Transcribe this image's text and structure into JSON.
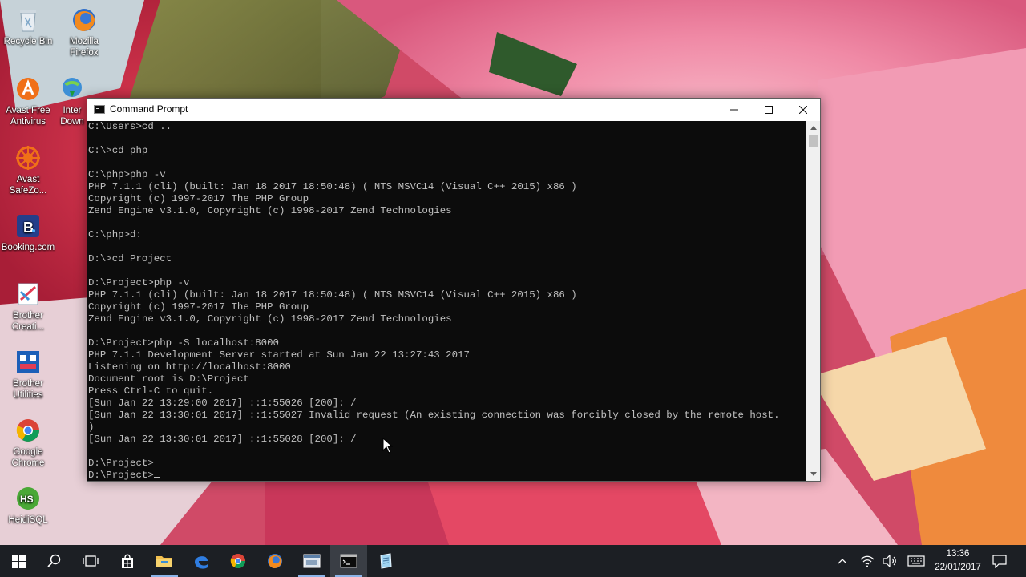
{
  "desktop": {
    "icons": [
      {
        "label": "Recycle Bin",
        "icon": "recycle-bin-icon"
      },
      {
        "label": "Mozilla Firefox",
        "icon": "firefox-icon"
      },
      {
        "label": "Avast Free Antivirus",
        "icon": "avast-icon"
      },
      {
        "label": "Inter Down",
        "icon": "internet-download-manager-icon"
      },
      {
        "label": "Avast SafeZo...",
        "icon": "avast-safezone-icon"
      },
      {
        "label": "Booking.com",
        "icon": "booking-icon"
      },
      {
        "label": "Brother Creati...",
        "icon": "brother-creative-icon"
      },
      {
        "label": "Brother Utilities",
        "icon": "brother-utilities-icon"
      },
      {
        "label": "Google Chrome",
        "icon": "chrome-icon"
      },
      {
        "label": "HeidiSQL",
        "icon": "heidisql-icon"
      }
    ]
  },
  "window": {
    "title": "Command Prompt",
    "minimize_glyph": "—",
    "maximize_glyph": "☐",
    "close_glyph": "✕"
  },
  "console": {
    "lines": [
      "C:\\Users>cd ..",
      "",
      "C:\\>cd php",
      "",
      "C:\\php>php -v",
      "PHP 7.1.1 (cli) (built: Jan 18 2017 18:50:48) ( NTS MSVC14 (Visual C++ 2015) x86 )",
      "Copyright (c) 1997-2017 The PHP Group",
      "Zend Engine v3.1.0, Copyright (c) 1998-2017 Zend Technologies",
      "",
      "C:\\php>d:",
      "",
      "D:\\>cd Project",
      "",
      "D:\\Project>php -v",
      "PHP 7.1.1 (cli) (built: Jan 18 2017 18:50:48) ( NTS MSVC14 (Visual C++ 2015) x86 )",
      "Copyright (c) 1997-2017 The PHP Group",
      "Zend Engine v3.1.0, Copyright (c) 1998-2017 Zend Technologies",
      "",
      "D:\\Project>php -S localhost:8000",
      "PHP 7.1.1 Development Server started at Sun Jan 22 13:27:43 2017",
      "Listening on http://localhost:8000",
      "Document root is D:\\Project",
      "Press Ctrl-C to quit.",
      "[Sun Jan 22 13:29:00 2017] ::1:55026 [200]: /",
      "[Sun Jan 22 13:30:01 2017] ::1:55027 Invalid request (An existing connection was forcibly closed by the remote host.",
      ")",
      "[Sun Jan 22 13:30:01 2017] ::1:55028 [200]: /",
      "",
      "D:\\Project>",
      "D:\\Project>"
    ]
  },
  "taskbar": {
    "buttons": [
      {
        "name": "start-button",
        "icon": "windows-icon"
      },
      {
        "name": "search-button",
        "icon": "search-icon"
      },
      {
        "name": "task-view-button",
        "icon": "task-view-icon"
      },
      {
        "name": "taskbar-store",
        "icon": "store-icon"
      },
      {
        "name": "taskbar-file-explorer",
        "icon": "folder-icon"
      },
      {
        "name": "taskbar-edge",
        "icon": "edge-icon"
      },
      {
        "name": "taskbar-chrome",
        "icon": "chrome-icon"
      },
      {
        "name": "taskbar-firefox",
        "icon": "firefox-icon"
      },
      {
        "name": "taskbar-app-window",
        "icon": "app-window-icon"
      },
      {
        "name": "taskbar-command-prompt",
        "icon": "command-prompt-icon"
      },
      {
        "name": "taskbar-notepad",
        "icon": "notepad-icon"
      }
    ],
    "clock": {
      "time": "13:36",
      "date": "22/01/2017"
    }
  },
  "colors": {
    "console_bg": "#0c0c0c",
    "console_text": "#c0c0c0",
    "taskbar_bg": "#1c1f24",
    "taskbar_active": "#8cb4e8"
  }
}
